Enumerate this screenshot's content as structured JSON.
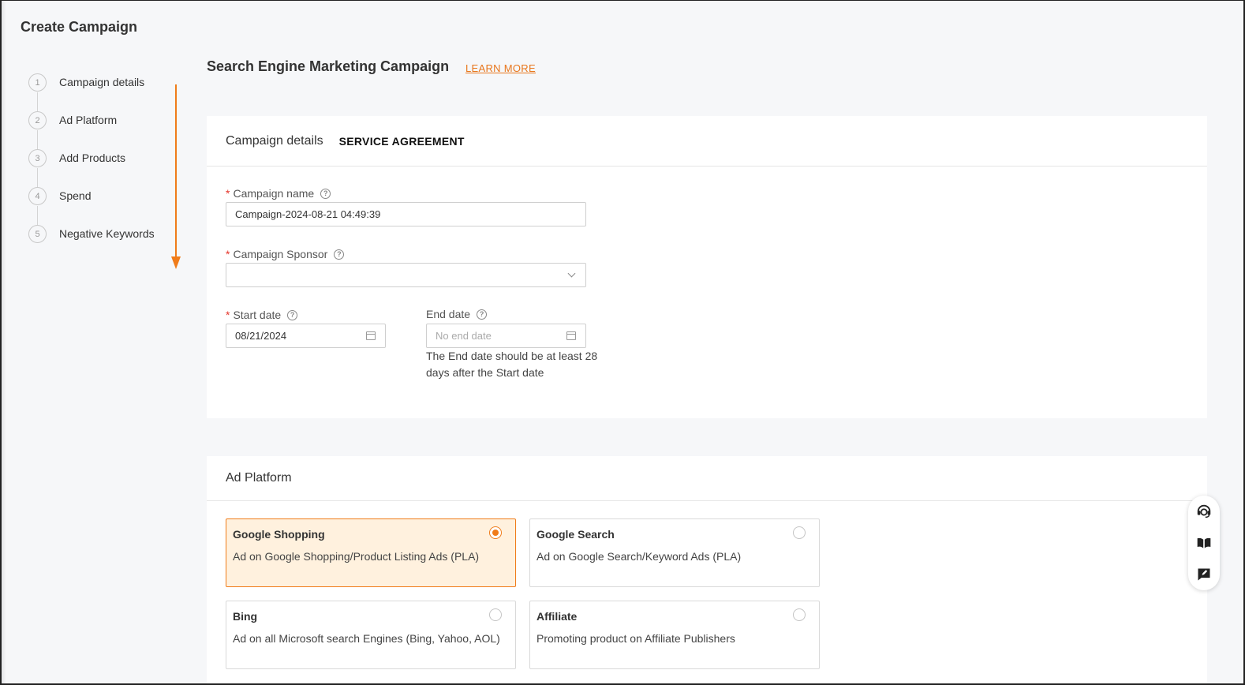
{
  "page": {
    "title": "Create Campaign"
  },
  "steps": [
    {
      "num": "1",
      "label": "Campaign details"
    },
    {
      "num": "2",
      "label": "Ad Platform"
    },
    {
      "num": "3",
      "label": "Add Products"
    },
    {
      "num": "4",
      "label": "Spend"
    },
    {
      "num": "5",
      "label": "Negative Keywords"
    }
  ],
  "header": {
    "title": "Search Engine Marketing Campaign",
    "learn_more": "LEARN MORE"
  },
  "details_card": {
    "title": "Campaign details",
    "tab_agreement": "SERVICE AGREEMENT",
    "campaign_name": {
      "label": "Campaign name",
      "value": "Campaign-2024-08-21 04:49:39"
    },
    "sponsor": {
      "label": "Campaign Sponsor",
      "value": ""
    },
    "start_date": {
      "label": "Start date",
      "value": "08/21/2024"
    },
    "end_date": {
      "label": "End date",
      "placeholder": "No end date",
      "hint": "The End date should be at least 28 days after the Start date"
    },
    "required_mark": "*",
    "help_glyph": "?"
  },
  "platform_card": {
    "title": "Ad Platform",
    "options": [
      {
        "title": "Google Shopping",
        "desc": "Ad on Google Shopping/Product Listing Ads (PLA)",
        "selected": true
      },
      {
        "title": "Google Search",
        "desc": "Ad on Google Search/Keyword Ads (PLA)",
        "selected": false
      },
      {
        "title": "Bing",
        "desc": "Ad on all Microsoft search Engines (Bing, Yahoo, AOL)",
        "selected": false
      },
      {
        "title": "Affiliate",
        "desc": "Promoting product on Affiliate Publishers",
        "selected": false
      }
    ]
  },
  "floating_widget": {
    "icons": [
      "support-agent-icon",
      "book-icon",
      "feedback-icon"
    ]
  },
  "colors": {
    "accent": "#f07c1a",
    "selected_bg": "#fff1de",
    "required": "#e5352b"
  }
}
